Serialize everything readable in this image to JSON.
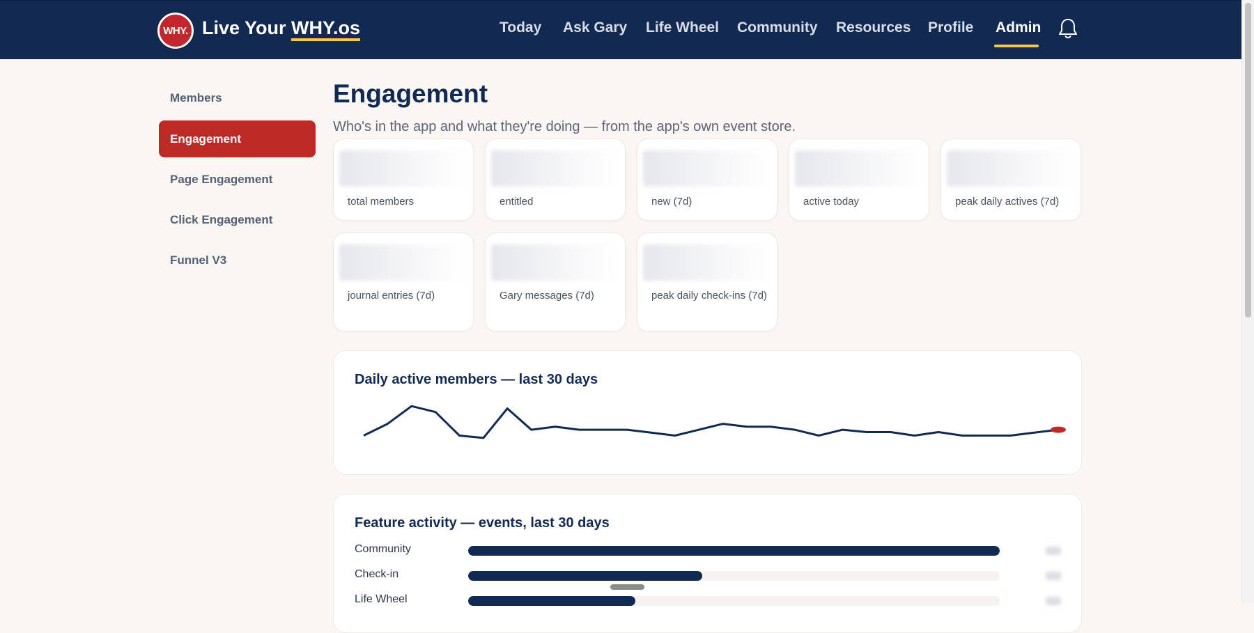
{
  "brand": {
    "badge_text": "WHY.",
    "name_prefix": "Live Your ",
    "name_suffix": "WHY.os",
    "accent": "#f2c94c",
    "badge_color": "#c2272d"
  },
  "nav": {
    "items": [
      {
        "label": "Today"
      },
      {
        "label": "Ask Gary"
      },
      {
        "label": "Life Wheel"
      },
      {
        "label": "Community"
      },
      {
        "label": "Resources"
      },
      {
        "label": "Profile"
      },
      {
        "label": "Admin",
        "active": true
      }
    ],
    "bell_icon": "bell-icon"
  },
  "sidebar": {
    "items": [
      {
        "label": "Members"
      },
      {
        "label": "Engagement",
        "active": true
      },
      {
        "label": "Page Engagement"
      },
      {
        "label": "Click Engagement"
      },
      {
        "label": "Funnel V3"
      }
    ],
    "active_color": "#bd2a25"
  },
  "page": {
    "title": "Engagement",
    "subtitle": "Who's in the app and what they're doing — from the app's own event store."
  },
  "stats": [
    {
      "label": "total members"
    },
    {
      "label": "entitled"
    },
    {
      "label": "new (7d)"
    },
    {
      "label": "active today"
    },
    {
      "label": "peak daily actives (7d)"
    },
    {
      "label": "journal entries (7d)"
    },
    {
      "label": "Gary messages (7d)"
    },
    {
      "label": "peak daily check-ins (7d)"
    }
  ],
  "daily_active": {
    "title": "Daily active members — last 30 days",
    "line_color": "#122952",
    "marker_color": "#c2272d"
  },
  "feature_activity": {
    "title": "Feature activity — events, last 30 days",
    "bar_color": "#122952"
  },
  "chart_data": [
    {
      "type": "line",
      "title": "Daily active members — last 30 days",
      "x": [
        1,
        2,
        3,
        4,
        5,
        6,
        7,
        8,
        9,
        10,
        11,
        12,
        13,
        14,
        15,
        16,
        17,
        18,
        19,
        20,
        21,
        22,
        23,
        24,
        25,
        26,
        27,
        28,
        29,
        30
      ],
      "values": [
        5,
        7,
        10,
        9,
        5,
        4.6,
        9.6,
        6,
        6.5,
        6,
        6,
        6,
        5.5,
        5,
        6,
        7,
        6.5,
        6.5,
        6,
        5,
        6,
        5.6,
        5.6,
        5,
        5.6,
        5,
        5,
        5,
        5.5,
        6
      ],
      "ylim": [
        4,
        10.5
      ],
      "grid": false,
      "highlight_last": true
    },
    {
      "type": "bar",
      "orientation": "horizontal",
      "title": "Feature activity — events, last 30 days",
      "categories": [
        "Community",
        "Check-in",
        "Life Wheel"
      ],
      "values": [
        1.0,
        0.44,
        0.315
      ]
    }
  ]
}
